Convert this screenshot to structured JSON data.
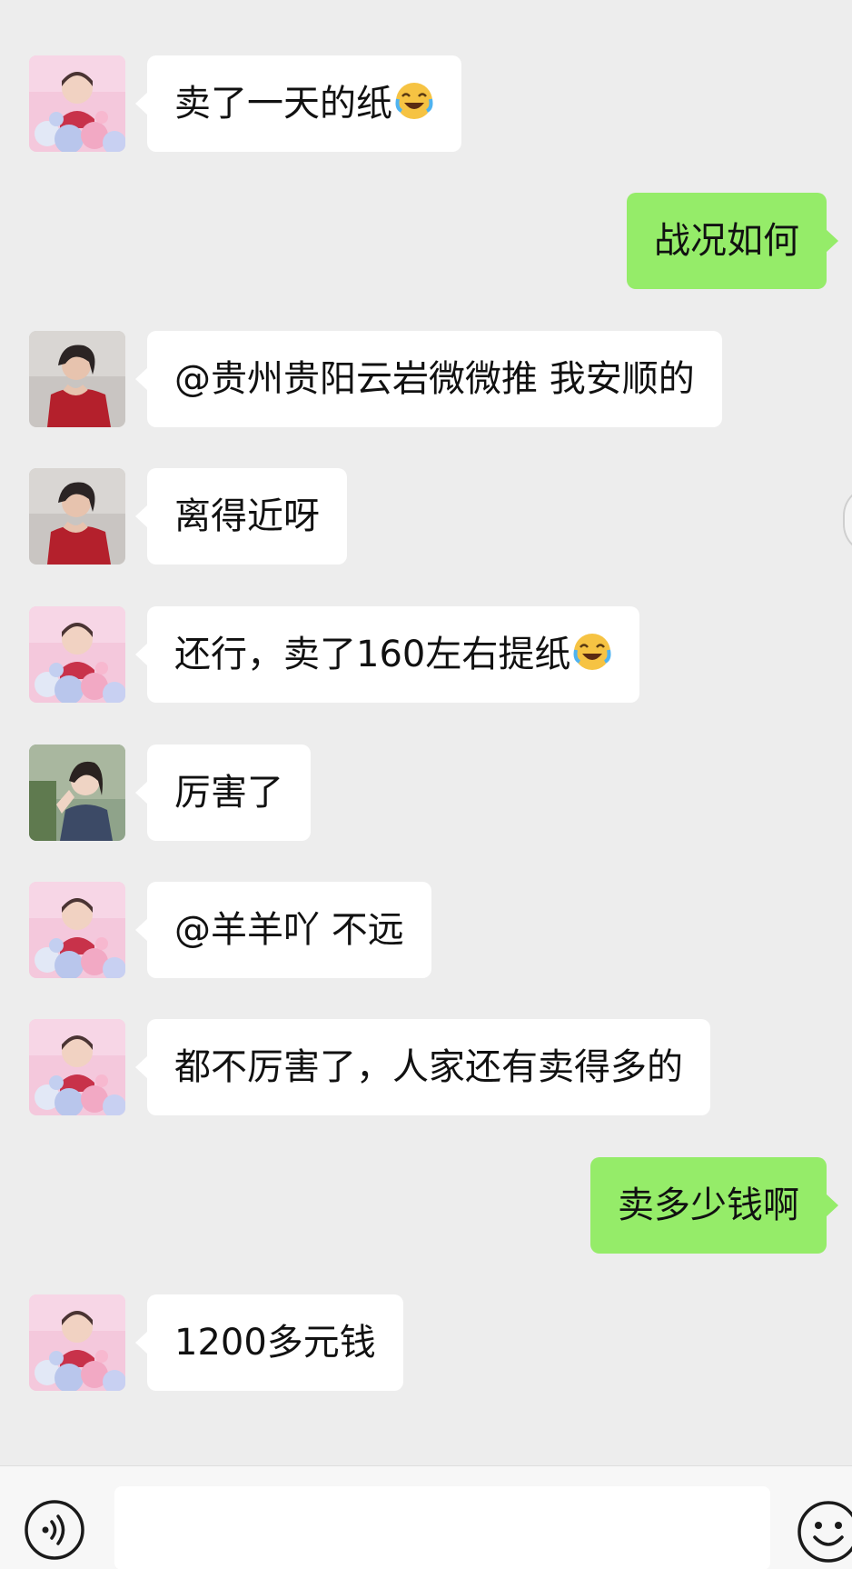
{
  "timestamps": {
    "top": "",
    "bottom": ""
  },
  "messages": [
    {
      "side": "left",
      "avatar": "avatar-pink-balloons",
      "text": "卖了一天的纸",
      "emoji": "laughing-crying-emoji"
    },
    {
      "side": "right",
      "text": "战况如何"
    },
    {
      "side": "left",
      "avatar": "avatar-dark-hair-red",
      "text": "@贵州贵阳云岩微微推 我安顺的"
    },
    {
      "side": "left",
      "avatar": "avatar-dark-hair-red",
      "text": "离得近呀"
    },
    {
      "side": "left",
      "avatar": "avatar-pink-balloons",
      "text": "还行，卖了160左右提纸",
      "emoji": "laughing-crying-emoji"
    },
    {
      "side": "left",
      "avatar": "avatar-outdoor-girl",
      "text": "厉害了"
    },
    {
      "side": "left",
      "avatar": "avatar-pink-balloons",
      "text": "@羊羊吖 不远"
    },
    {
      "side": "left",
      "avatar": "avatar-pink-balloons",
      "text": "都不厉害了，人家还有卖得多的"
    },
    {
      "side": "right",
      "text": "卖多少钱啊"
    },
    {
      "side": "left",
      "avatar": "avatar-pink-balloons",
      "text": "1200多元钱"
    }
  ],
  "input_bar": {
    "voice_icon": "voice-input-icon",
    "input_value": "",
    "emoji_icon": "smiley-face-icon"
  },
  "colors": {
    "background": "#ededed",
    "incoming_bubble": "#ffffff",
    "outgoing_bubble": "#95ec69",
    "text": "#111111"
  }
}
